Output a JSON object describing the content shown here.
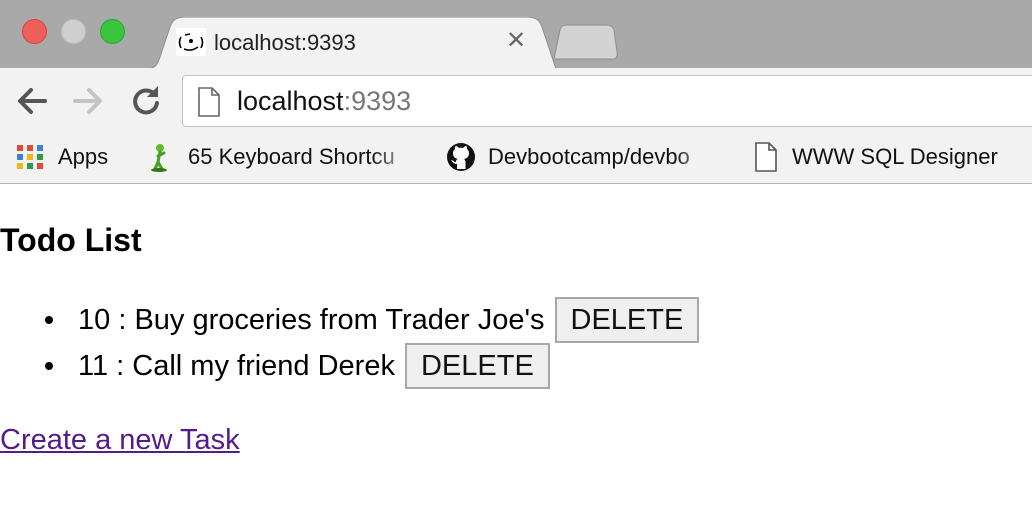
{
  "browser": {
    "tab": {
      "title": "localhost:9393",
      "favicon": "smiley-favicon-icon",
      "close_icon": "close-icon"
    },
    "url": {
      "host": "localhost",
      "port": ":9393"
    },
    "bookmarks": [
      {
        "label": "Apps",
        "icon": "apps-grid-icon"
      },
      {
        "label": "65 Keyboard Shortcu",
        "icon": "green-figure-icon"
      },
      {
        "label": "Devbootcamp/devbo",
        "icon": "github-icon"
      },
      {
        "label": "WWW SQL Designer",
        "icon": "page-icon"
      }
    ],
    "colors": {
      "close": "#ee5f5b",
      "minimize": "#cfcfcf",
      "maximize": "#3bc43e",
      "titlebar": "#a9a9a9",
      "toolbar": "#f2f2f2"
    }
  },
  "page": {
    "title": "Todo List",
    "todos": [
      {
        "id": "10",
        "sep": " : ",
        "text": "Buy groceries from Trader Joe's",
        "button": "DELETE"
      },
      {
        "id": "11",
        "sep": " : ",
        "text": "Call my friend Derek",
        "button": "DELETE"
      }
    ],
    "create_link": "Create a new Task",
    "link_color": "#551a8b"
  }
}
